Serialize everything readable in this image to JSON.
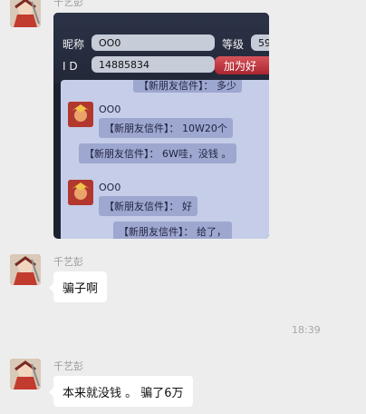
{
  "colors": {
    "background": "#ededed",
    "bubble": "#ffffff",
    "accent_red": "#c84a3f"
  },
  "messages": [
    {
      "sender": "千艺彭",
      "type": "image",
      "image": {
        "nickname_label": "昵称",
        "nickname_value": "OO0",
        "level_label": "等级",
        "level_value": "59",
        "id_label": "I D",
        "id_value": "14885834",
        "add_button": "加为好",
        "chat": [
          {
            "text": "【新朋友信件】： 多少"
          },
          {
            "name": "OO0",
            "text": "【新朋友信件】： 10W20个"
          },
          {
            "text": "【新朋友信件】： 6W哇，没钱 。"
          },
          {
            "name": "OO0",
            "text": "【新朋友信件】： 好"
          },
          {
            "text": "【新朋友信件】： 给了，"
          }
        ]
      }
    },
    {
      "sender": "千艺彭",
      "type": "text",
      "text": "骗子啊"
    },
    {
      "sender": "千艺彭",
      "type": "text",
      "text": "本来就没钱 。 骗了6万"
    }
  ],
  "timestamp": "18:39"
}
